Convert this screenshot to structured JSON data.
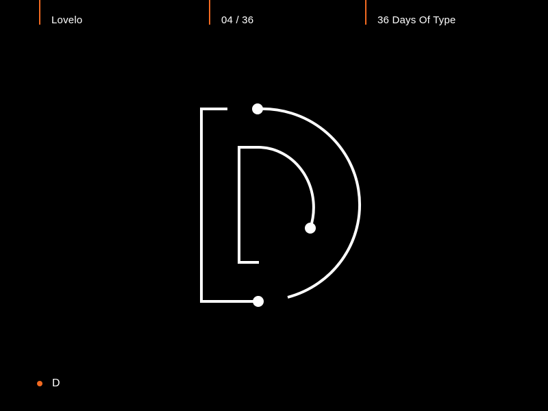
{
  "colors": {
    "background": "#000000",
    "foreground": "#ffffff",
    "accent": "#f26a21"
  },
  "header": {
    "brand": "Lovelo",
    "counter": "04 / 36",
    "series": "36 Days Of Type"
  },
  "artwork": {
    "letter": "D",
    "icon": "letter-d-line-art"
  },
  "footer": {
    "icon": "accent-dot",
    "letter": "D"
  }
}
